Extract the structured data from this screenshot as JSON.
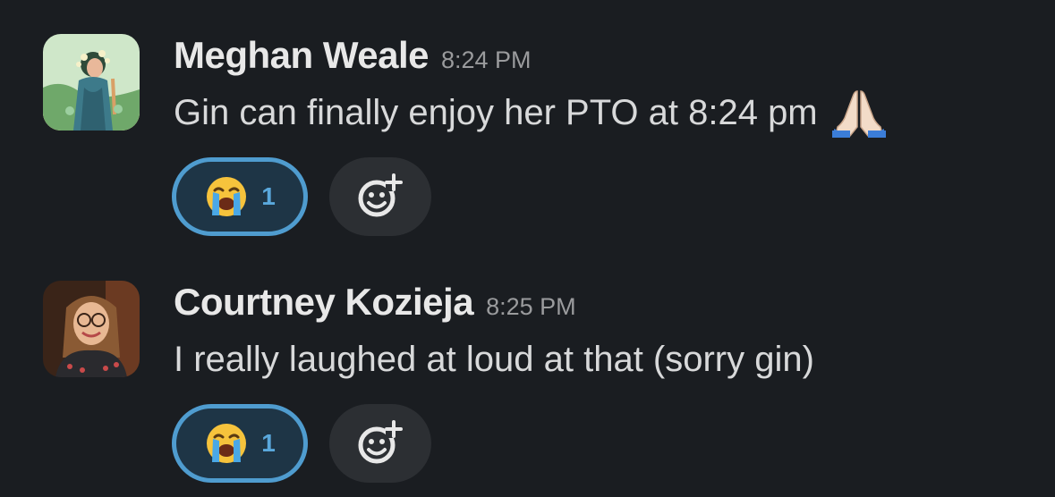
{
  "messages": [
    {
      "author": "Meghan Weale",
      "time": "8:24 PM",
      "text": "Gin can finally enjoy her PTO at 8:24 pm",
      "inline_emoji": "folded-hands-icon",
      "reaction": {
        "emoji": "loudly-crying-face-icon",
        "count": "1"
      },
      "add_reaction_icon": "add-reaction-icon"
    },
    {
      "author": "Courtney Kozieja",
      "time": "8:25 PM",
      "text": "I really laughed at loud at that (sorry gin)",
      "reaction": {
        "emoji": "loudly-crying-face-icon",
        "count": "1"
      },
      "add_reaction_icon": "add-reaction-icon"
    }
  ],
  "colors": {
    "background": "#1a1d21",
    "reaction_border": "#4f9ccf",
    "reaction_bg": "#1e3546",
    "reaction_count": "#5aa8dc",
    "add_reaction_bg": "#2c2f33"
  }
}
